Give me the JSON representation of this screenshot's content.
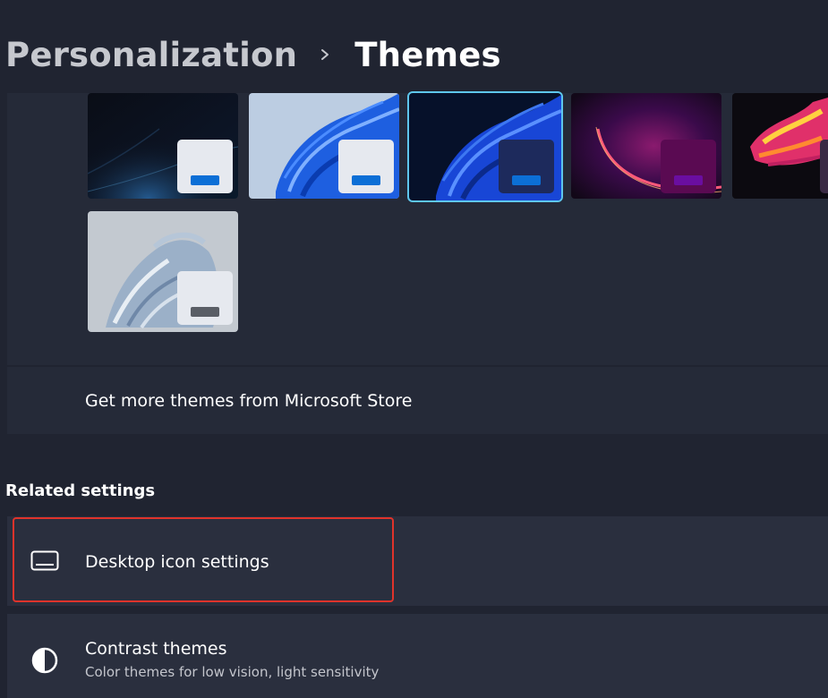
{
  "breadcrumb": {
    "parent": "Personalization",
    "current": "Themes",
    "separator_icon": "chevron-right-icon"
  },
  "themes": [
    {
      "id": "dark-flow",
      "selected": false,
      "swatch_color": "#e6e9ef",
      "bar_color": "#0c6fd6"
    },
    {
      "id": "light-bloom",
      "selected": false,
      "swatch_color": "#e6e9ef",
      "bar_color": "#0c6fd6"
    },
    {
      "id": "dark-bloom",
      "selected": true,
      "swatch_color": "#1d2a5c",
      "bar_color": "#0c6fd6"
    },
    {
      "id": "glow",
      "selected": false,
      "swatch_color": "#5a0a52",
      "bar_color": "#6a0ea0"
    },
    {
      "id": "captured-motion",
      "selected": false,
      "swatch_color": "#3a2a44",
      "bar_color": "#d83a8a"
    },
    {
      "id": "sunrise",
      "selected": false,
      "swatch_color": "#e6e9ef",
      "bar_color": "#5a5e66"
    }
  ],
  "store_link": "Get more themes from Microsoft Store",
  "related": {
    "title": "Related settings",
    "desktop_icon": {
      "label": "Desktop icon settings",
      "icon": "monitor-icon"
    },
    "contrast": {
      "label": "Contrast themes",
      "sublabel": "Color themes for low vision, light sensitivity",
      "icon": "contrast-icon"
    }
  },
  "colors": {
    "background": "#202431",
    "card": "#252a38",
    "row": "#2a2f3e",
    "selected_outline": "#5ec7ec",
    "highlight_box": "#e0332b",
    "accent": "#0c6fd6"
  }
}
